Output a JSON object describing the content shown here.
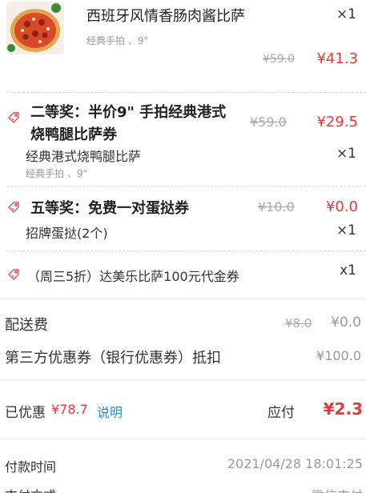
{
  "items": [
    {
      "name": "西班牙风情香肠肉酱比萨",
      "spec": "经典手拍 、9\"",
      "qty": "×1",
      "original_price": "¥59.0",
      "price": "¥41.3"
    }
  ],
  "prizes": [
    {
      "title_line1": "二等奖：半价9\" 手拍经典港式",
      "title_line2": "烧鸭腿比萨券",
      "original_price": "¥59.0",
      "price": "¥29.5",
      "item_name": "经典港式烧鸭腿比萨",
      "item_spec": "经典手拍 、9\"",
      "qty": "×1"
    },
    {
      "title": "五等奖：免费一对蛋挞券",
      "original_price": "¥10.0",
      "price": "¥0.0",
      "item_name": "招牌蛋挞(2个)",
      "qty": "×1"
    }
  ],
  "voucher": {
    "title": "（周三5折）达美乐比萨100元代金券",
    "qty": "x1"
  },
  "fees": {
    "delivery_label": "配送费",
    "delivery_original": "¥8.0",
    "delivery_price": "¥0.0",
    "third_party_label": "第三方优惠券（银行优惠券）抵扣",
    "third_party_value": "¥100.0"
  },
  "summary": {
    "discount_label": "已优惠",
    "discount_value": "¥78.7",
    "explain_link": "说明",
    "payable_label": "应付",
    "payable_value": "¥2.3"
  },
  "payment": {
    "time_label": "付款时间",
    "time_value": "2021/04/28 18:01:25",
    "method_label": "支付方式",
    "method_value": "微信支付"
  },
  "colors": {
    "accent_red": "#e4393c",
    "link_blue": "#1e90d6",
    "icon_red": "#d9534f"
  }
}
